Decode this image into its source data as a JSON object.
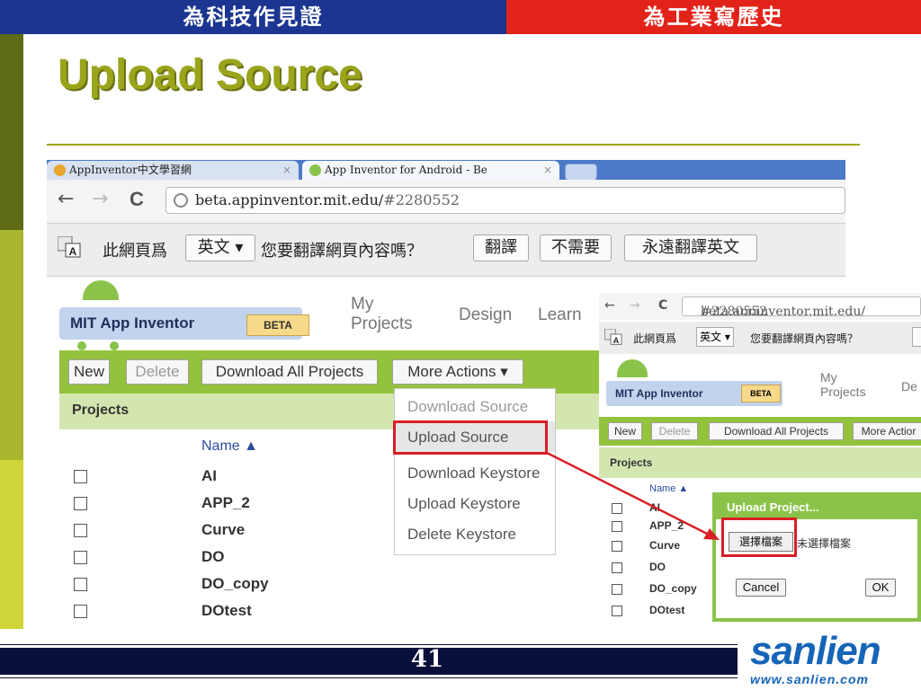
{
  "slide": {
    "banner_left": "為科技作見證",
    "banner_right": "為工業寫歷史",
    "title": "Upload Source",
    "page_number": "41",
    "brand_name": "sanlien",
    "brand_url": "www.sanlien.com",
    "colors": {
      "banner_left": "#1b3590",
      "banner_right": "#e2231a",
      "title": "#9aa51c",
      "highlight": "#d81f26"
    }
  },
  "browser": {
    "tab1": "AppInventor中文學習網",
    "tab2": "App Inventor for Android - Be",
    "tab_close": "×",
    "back": "←",
    "forward": "→",
    "reload": "C",
    "url_host": "beta.appinventor.mit.edu/",
    "url_path": "#2280552",
    "translate": {
      "prefix": "此網頁爲",
      "language": "英文",
      "question": "您要翻譯網頁內容嗎？",
      "translate_btn": "翻譯",
      "no_btn": "不需要",
      "always_btn": "永遠翻譯英文"
    }
  },
  "app": {
    "logo": "MIT App Inventor",
    "beta": "BETA",
    "nav_my": "My",
    "nav_projects": "Projects",
    "nav_design": "Design",
    "nav_learn": "Learn",
    "toolbar": {
      "new": "New",
      "delete": "Delete",
      "download_all": "Download All Projects",
      "more_actions": "More Actions ▾"
    },
    "projects_header": "Projects",
    "column_name": "Name ▲",
    "projects": [
      "AI",
      "APP_2",
      "Curve",
      "DO",
      "DO_copy",
      "DOtest"
    ],
    "menu": {
      "download_source": "Download Source",
      "upload_source": "Upload Source",
      "download_keystore": "Download Keystore",
      "upload_keystore": "Upload Keystore",
      "delete_keystore": "Delete Keystore"
    }
  },
  "small_browser": {
    "url_host": "beta.appinventor.mit.edu/",
    "url_path": "#2280552",
    "translate_prefix": "此網頁爲",
    "translate_language": "英文",
    "translate_question": "您要翻譯網頁內容嗎？",
    "logo": "MIT App Inventor",
    "beta": "BETA",
    "nav_my": "My",
    "nav_projects": "Projects",
    "nav_design": "De",
    "toolbar": {
      "new": "New",
      "delete": "Delete",
      "download_all": "Download All Projects",
      "more_actions": "More Actior"
    },
    "projects_header": "Projects",
    "column_name": "Name ▲",
    "projects": [
      "AI",
      "APP_2",
      "Curve",
      "DO",
      "DO_copy",
      "DOtest"
    ],
    "dialog": {
      "title": "Upload Project...",
      "choose_file": "選擇檔案",
      "no_file": "未選擇檔案",
      "cancel": "Cancel",
      "ok": "OK"
    }
  }
}
